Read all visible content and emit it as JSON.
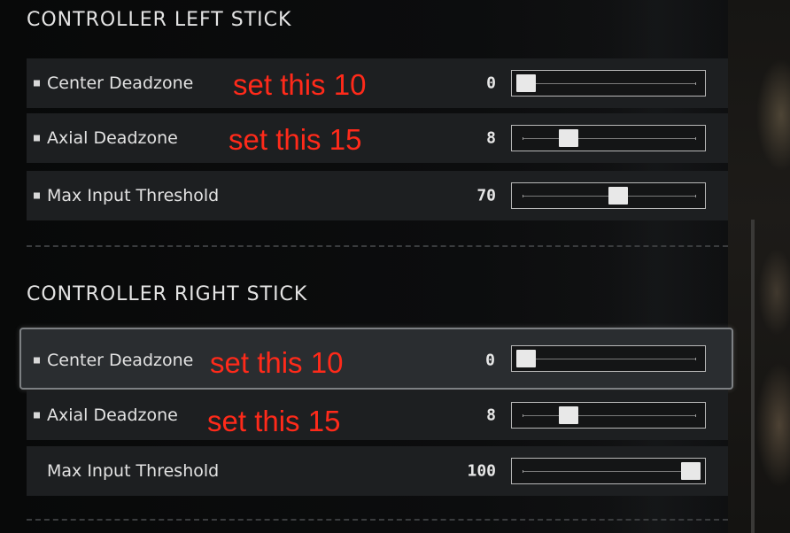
{
  "left_stick": {
    "title": "CONTROLLER LEFT STICK",
    "rows": [
      {
        "label": "Center Deadzone",
        "value": "0",
        "annotation": "set this 10",
        "has_bullet": true,
        "slider_fraction": 0.0
      },
      {
        "label": "Axial Deadzone",
        "value": "8",
        "annotation": "set this 15",
        "has_bullet": true,
        "slider_fraction": 0.26
      },
      {
        "label": "Max Input Threshold",
        "value": "70",
        "annotation": "",
        "has_bullet": true,
        "slider_fraction": 0.56
      }
    ]
  },
  "right_stick": {
    "title": "CONTROLLER RIGHT STICK",
    "rows": [
      {
        "label": "Center Deadzone",
        "value": "0",
        "annotation": "set this 10",
        "has_bullet": true,
        "slider_fraction": 0.0,
        "focused": true
      },
      {
        "label": "Axial Deadzone",
        "value": "8",
        "annotation": "set this 15",
        "has_bullet": true,
        "slider_fraction": 0.26
      },
      {
        "label": "Max Input Threshold",
        "value": "100",
        "annotation": "",
        "has_bullet": false,
        "slider_fraction": 1.0
      }
    ]
  },
  "colors": {
    "annotation": "#ff2a1a",
    "focus_border": "#7d8083",
    "row_bg": "#1d1f21"
  }
}
